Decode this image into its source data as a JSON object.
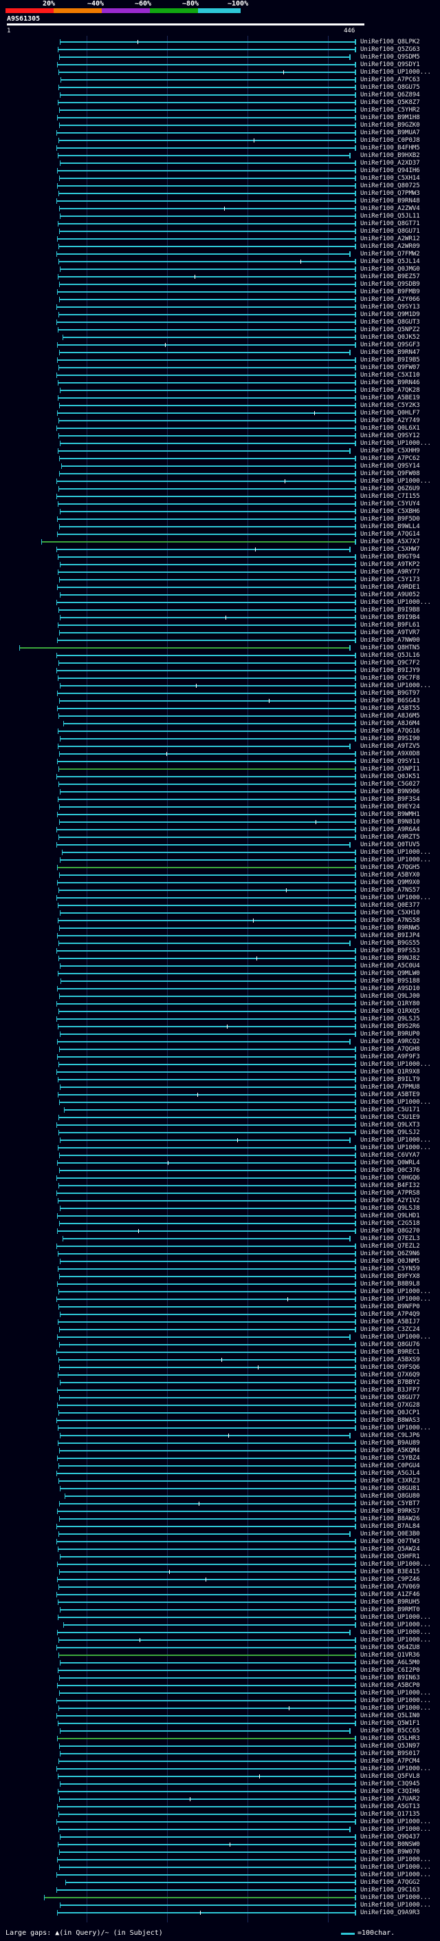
{
  "query": {
    "name": "A9S61305",
    "start": "1",
    "end": "446"
  },
  "scale": [
    {
      "label": "20%",
      "color": "#ff1a1a"
    },
    {
      "label": "~40%",
      "color": "#f07a00"
    },
    {
      "label": "~60%",
      "color": "#9a2ad0"
    },
    {
      "label": "~80%",
      "color": "#11a611"
    },
    {
      "label": "~100%",
      "color": "#2ec8d8"
    }
  ],
  "hits": [
    "UniRef100_Q8LPK2",
    "UniRef100_Q5ZG63",
    "UniRef100_Q9SDM5",
    "UniRef100_Q9SDY1",
    "UniRef100_UP1000...",
    "UniRef100_A7PC63",
    "UniRef100_Q8GU75",
    "UniRef100_Q6Z894",
    "UniRef100_Q5K8Z7",
    "UniRef100_C5YHR2",
    "UniRef100_B9M1H8",
    "UniRef100_B9GZK0",
    "UniRef100_B9MUA7",
    "UniRef100_C0P0J8",
    "UniRef100_B4FHM5",
    "UniRef100_B9HXB2",
    "UniRef100_A2XD37",
    "UniRef100_Q94IH6",
    "UniRef100_C5XH14",
    "UniRef100_Q80725",
    "UniRef100_Q7PMW3",
    "UniRef100_B9RN48",
    "UniRef100_A2ZWV4",
    "UniRef100_Q5JL11",
    "UniRef100_Q8GT71",
    "UniRef100_Q8GU71",
    "UniRef100_A2WR12",
    "UniRef100_A2WR09",
    "UniRef100_Q7FMW2",
    "UniRef100_Q5JL14",
    "UniRef100_Q0JMG0",
    "UniRef100_B9EZ57",
    "UniRef100_Q9SDB9",
    "UniRef100_B9FMB9",
    "UniRef100_A2Y066",
    "UniRef100_Q9SY13",
    "UniRef100_Q9M1D9",
    "UniRef100_Q8GUT3",
    "UniRef100_Q5NPZ2",
    "UniRef100_Q0JK52",
    "UniRef100_Q9SGF3",
    "UniRef100_B9RN47",
    "UniRef100_B9I9B5",
    "UniRef100_Q9FW07",
    "UniRef100_C5XI10",
    "UniRef100_B9RN46",
    "UniRef100_A7QK28",
    "UniRef100_A5BE19",
    "UniRef100_C5Y2K3",
    "UniRef100_Q0HLF7",
    "UniRef100_A2Y749",
    "UniRef100_Q0L6X1",
    "UniRef100_Q9SY12",
    "UniRef100_UP1000...",
    "UniRef100_C5XHH9",
    "UniRef100_A7PC62",
    "UniRef100_Q9SY14",
    "UniRef100_Q9FW08",
    "UniRef100_UP1000...",
    "UniRef100_Q6Z6U9",
    "UniRef100_C7I155",
    "UniRef100_C5YUY4",
    "UniRef100_C5XBH6",
    "UniRef100_B9F5D0",
    "UniRef100_B9WLL4",
    "UniRef100_A7QG14",
    "UniRef100_A5X7X7",
    "UniRef100_C5XHW7",
    "UniRef100_B9GT94",
    "UniRef100_A9TKP2",
    "UniRef100_A9RY77",
    "UniRef100_C5Y173",
    "UniRef100_A9RDE1",
    "UniRef100_A9U052",
    "UniRef100_UP1000...",
    "UniRef100_B9I9B8",
    "UniRef100_B9I9B4",
    "UniRef100_B9FL61",
    "UniRef100_A9TVR7",
    "UniRef100_A7NW00",
    "UniRef100_Q8HTN5",
    "UniRef100_Q5JL16",
    "UniRef100_Q9C7F2",
    "UniRef100_B9IJY9",
    "UniRef100_Q9C7F8",
    "UniRef100_UP1000...",
    "UniRef100_B9GT97",
    "UniRef100_B6SG43",
    "UniRef100_A5BT55",
    "UniRef100_A8J6M5",
    "UniRef100_A8J6M4",
    "UniRef100_A7QG16",
    "UniRef100_B9SI90",
    "UniRef100_A9TZV5",
    "UniRef100_A9X0D8",
    "UniRef100_Q9SY11",
    "UniRef100_Q5NPI1",
    "UniRef100_Q0JK51",
    "UniRef100_C5G027",
    "UniRef100_B9N906",
    "UniRef100_B9F3S4",
    "UniRef100_B9EY24",
    "UniRef100_B9WMH1",
    "UniRef100_B9N810",
    "UniRef100_A9R6A4",
    "UniRef100_A9RZT5",
    "UniRef100_Q0TUV5",
    "UniRef100_UP1000...",
    "UniRef100_UP1000...",
    "UniRef100_A7QGH5",
    "UniRef100_A5BYX0",
    "UniRef100_Q9M9X0",
    "UniRef100_A7NS57",
    "UniRef100_UP1000...",
    "UniRef100_Q0E377",
    "UniRef100_C5XH10",
    "UniRef100_A7NS58",
    "UniRef100_B9RNW5",
    "UniRef100_B9IJP4",
    "UniRef100_B9GS55",
    "UniRef100_B9FS53",
    "UniRef100_B9NJ82",
    "UniRef100_A5C0U4",
    "UniRef100_Q9MLW0",
    "UniRef100_B9S188",
    "UniRef100_A9SD10",
    "UniRef100_Q9LJ00",
    "UniRef100_Q1RY80",
    "UniRef100_Q1RXQ5",
    "UniRef100_Q9LSJ5",
    "UniRef100_B9S2R6",
    "UniRef100_B9RUP0",
    "UniRef100_A9RCQ2",
    "UniRef100_A7QGH8",
    "UniRef100_A9F9F3",
    "UniRef100_UP1000...",
    "UniRef100_Q1R9X8",
    "UniRef100_B9ILT9",
    "UniRef100_A7PMU8",
    "UniRef100_A5BTE9",
    "UniRef100_UP1000...",
    "UniRef100_C5U171",
    "UniRef100_C5U1E9",
    "UniRef100_Q9LXT3",
    "UniRef100_Q9LSJ2",
    "UniRef100_UP1000...",
    "UniRef100_UP1000...",
    "UniRef100_C6VYA7",
    "UniRef100_Q0WRL4",
    "UniRef100_Q0C376",
    "UniRef100_C0HGQ6",
    "UniRef100_B4FI32",
    "UniRef100_A7PRS8",
    "UniRef100_A2Y1V2",
    "UniRef100_Q9LSJ8",
    "UniRef100_Q9LHD1",
    "UniRef100_C2G518",
    "UniRef100_Q8G270",
    "UniRef100_Q7EZL3",
    "UniRef100_Q7EZL2",
    "UniRef100_Q6Z9N6",
    "UniRef100_Q0JNM5",
    "UniRef100_C5YN59",
    "UniRef100_B9FYX8",
    "UniRef100_B8B9L8",
    "UniRef100_UP1000...",
    "UniRef100_UP1000...",
    "UniRef100_B9NFP0",
    "UniRef100_A7P4Q9",
    "UniRef100_A5BIJ7",
    "UniRef100_C3ZC24",
    "UniRef100_UP1000...",
    "UniRef100_Q8GU76",
    "UniRef100_B9REC1",
    "UniRef100_A5BXS9",
    "UniRef100_Q9FSQ6",
    "UniRef100_Q7X6Q9",
    "UniRef100_B7BBY2",
    "UniRef100_B3JFP7",
    "UniRef100_Q8GU77",
    "UniRef100_Q7XG28",
    "UniRef100_Q0JCP1",
    "UniRef100_B8WAS3",
    "UniRef100_UP1000...",
    "UniRef100_C9LJP6",
    "UniRef100_B9AU89",
    "UniRef100_A5KQM4",
    "UniRef100_C5YBZ4",
    "UniRef100_C0PGU4",
    "UniRef100_A5GJL4",
    "UniRef100_C3XRZ3",
    "UniRef100_Q8GU81",
    "UniRef100_Q8GU80",
    "UniRef100_C5YBT7",
    "UniRef100_B9RKS7",
    "UniRef100_B8AW26",
    "UniRef100_B7AL84",
    "UniRef100_Q0E3B0",
    "UniRef100_Q07TW3",
    "UniRef100_Q5AW24",
    "UniRef100_Q5HFR1",
    "UniRef100_UP1000...",
    "UniRef100_B3E415",
    "UniRef100_C9PZ46",
    "UniRef100_A7V069",
    "UniRef100_A1ZF46",
    "UniRef100_B9RUH5",
    "UniRef100_B9RMT0",
    "UniRef100_UP1000...",
    "UniRef100_UP1000...",
    "UniRef100_UP1000...",
    "UniRef100_UP1000...",
    "UniRef100_Q64ZU8",
    "UniRef100_Q1VR36",
    "UniRef100_A6L5M0",
    "UniRef100_C6I2P0",
    "UniRef100_B9IN63",
    "UniRef100_A5BCP0",
    "UniRef100_UP1000...",
    "UniRef100_UP1000...",
    "UniRef100_UP1000...",
    "UniRef100_Q5LIN0",
    "UniRef100_Q5W1F1",
    "UniRef100_B5CC65",
    "UniRef100_Q5LHR3",
    "UniRef100_Q5JN97",
    "UniRef100_B9S017",
    "UniRef100_A7PCM4",
    "UniRef100_UP1000...",
    "UniRef100_Q5FVL8",
    "UniRef100_C3Q945",
    "UniRef100_C3QIH6",
    "UniRef100_A7UAR2",
    "UniRef100_A5GT13",
    "UniRef100_Q17135",
    "UniRef100_UP1000...",
    "UniRef100_UP1000...",
    "UniRef100_Q9Q437",
    "UniRef100_B0NSW0",
    "UniRef100_B9W070",
    "UniRef100_UP1000...",
    "UniRef100_UP1000...",
    "UniRef100_UP1000...",
    "UniRef100_A7QGG2",
    "UniRef100_Q9C163",
    "UniRef100_UP1000...",
    "UniRef100_UP1000...",
    "UniRef100_Q9A9R3"
  ],
  "footer": {
    "large_gaps_label": "Large gaps: ▲(in Query)/~ (in Subject)",
    "scale_label": "=100char."
  }
}
